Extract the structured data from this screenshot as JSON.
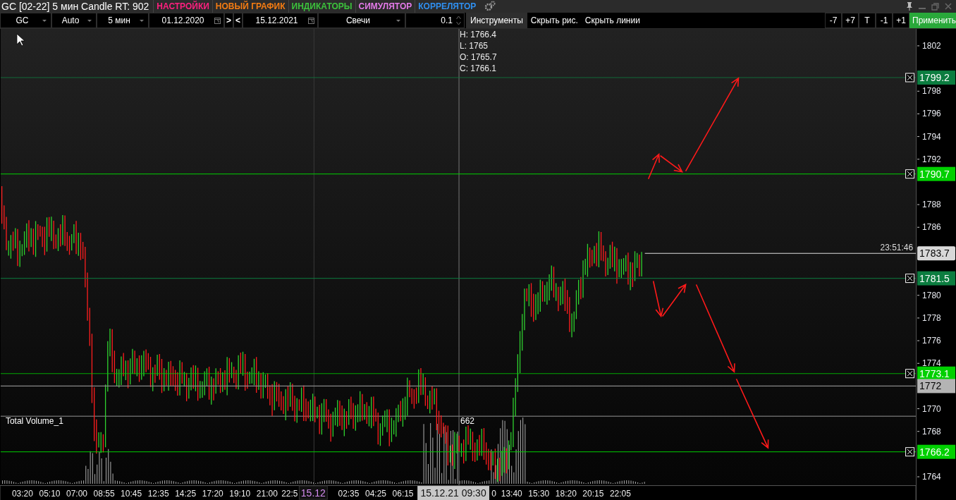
{
  "window": {
    "title": "GC [02-22] 5 мин Candle RT: 902"
  },
  "menu": [
    {
      "label": "НАСТРОЙКИ",
      "color": "#ff1f7f"
    },
    {
      "label": "НОВЫЙ ГРАФИК",
      "color": "#f57c12"
    },
    {
      "label": "ИНДИКАТОРЫ",
      "color": "#3cc23c"
    },
    {
      "label": "СИМУЛЯТОР",
      "color": "#e37ae8"
    },
    {
      "label": "КОРРЕЛЯТОР",
      "color": "#2f8ff0"
    }
  ],
  "toolbar": {
    "symbol": "GC",
    "scale": "Auto",
    "interval": "5 мин",
    "date_from": "01.12.2020",
    "forward": ">",
    "back": "<",
    "date_to": "15.12.2021",
    "chart_type": "Свечи",
    "step": "0.1",
    "buttons": [
      "Инструменты",
      "Скрыть рис.",
      "Скрыть линии"
    ],
    "shift_buttons": [
      "-7",
      "+7",
      "T",
      "-1",
      "+1"
    ],
    "apply": "Применить"
  },
  "ohlc": [
    "H: 1766.4",
    "L: 1765",
    "O: 1765.7",
    "C: 1766.1"
  ],
  "price_axis": [
    "1802",
    "1798",
    "1796",
    "1794",
    "1792",
    "1788",
    "1786",
    "1780",
    "1778",
    "1776",
    "1774",
    "1770",
    "1768",
    "1764"
  ],
  "levels": [
    {
      "kind": "alert",
      "price": "1799.2",
      "color": "#0c7d40"
    },
    {
      "kind": "alert",
      "price": "1790.7",
      "color": "#00d000"
    },
    {
      "kind": "alert",
      "price": "1781.5",
      "color": "#0c7d40"
    },
    {
      "kind": "alert",
      "price": "1773.1",
      "color": "#00d000"
    },
    {
      "kind": "plain",
      "price": "1772",
      "color": "#b4b4b4"
    },
    {
      "kind": "alert",
      "price": "1766.2",
      "color": "#00d000"
    }
  ],
  "last_price": {
    "price": "1783.7",
    "time": "23:51:46"
  },
  "volume_pane": {
    "title": "Total Volume_1",
    "reading": "662"
  },
  "time_axis": [
    "03:20",
    "05:10",
    "07:00",
    "08:55",
    "10:45",
    "12:35",
    "14:25",
    "17:20",
    "19:10",
    "21:00",
    "22:5",
    "02:35",
    "04:25",
    "06:15",
    "0",
    "13:40",
    "15:30",
    "18:20",
    "20:15",
    "22:05"
  ],
  "date_marker": "15.12",
  "crosshair_time": "15.12.21 09:30"
}
